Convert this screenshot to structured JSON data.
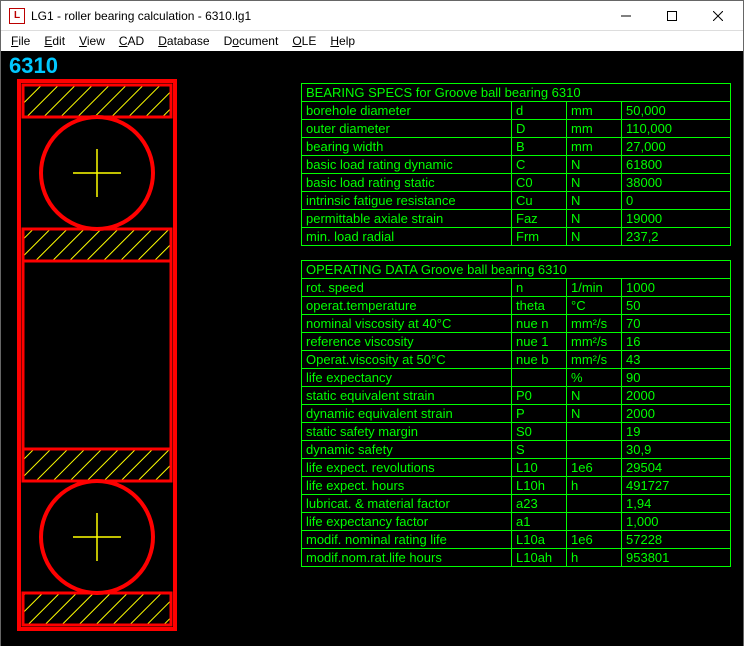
{
  "window": {
    "title": "LG1 -  roller bearing calculation  -  6310.lg1"
  },
  "menu": [
    "File",
    "Edit",
    "View",
    "CAD",
    "Database",
    "Document",
    "OLE",
    "Help"
  ],
  "part_label": "6310",
  "specs": {
    "title": "BEARING SPECS for Groove ball bearing 6310",
    "rows": [
      {
        "label": "borehole diameter",
        "sym": "d",
        "unit": "mm",
        "val": " 50,000"
      },
      {
        "label": "outer diameter",
        "sym": "D",
        "unit": "mm",
        "val": "110,000"
      },
      {
        "label": "bearing width",
        "sym": "B",
        "unit": "mm",
        "val": " 27,000"
      },
      {
        "label": "basic load rating dynamic",
        "sym": "C",
        "unit": "N",
        "val": "61800"
      },
      {
        "label": "basic load rating static",
        "sym": "C0",
        "unit": "N",
        "val": "38000"
      },
      {
        "label": "intrinsic fatigue resistance",
        "sym": "Cu",
        "unit": "N",
        "val": "0"
      },
      {
        "label": "permittable axiale strain",
        "sym": "Faz",
        "unit": "N",
        "val": "19000"
      },
      {
        "label": "min. load radial",
        "sym": "Frm",
        "unit": "N",
        "val": "237,2"
      }
    ]
  },
  "operating": {
    "title": "OPERATING DATA  Groove ball bearing 6310",
    "rows": [
      {
        "label": "rot. speed",
        "sym": "n",
        "unit": "1/min",
        "val": "1000"
      },
      {
        "label": "operat.temperature",
        "sym": "theta",
        "unit": "°C",
        "val": "50"
      },
      {
        "label": "nominal viscosity at 40°C",
        "sym": "nue n",
        "unit": "mm²/s",
        "val": "70"
      },
      {
        "label": "reference viscosity",
        "sym": "nue 1",
        "unit": "mm²/s",
        "val": "16"
      },
      {
        "label": "Operat.viscosity at 50°C",
        "sym": "nue b",
        "unit": "mm²/s",
        "val": "43"
      },
      {
        "label": "life expectancy",
        "sym": "",
        "unit": "%",
        "val": "90"
      },
      {
        "label": "static equivalent strain",
        "sym": "P0",
        "unit": "N",
        "val": "2000"
      },
      {
        "label": "dynamic equivalent strain",
        "sym": "P",
        "unit": "N",
        "val": "2000"
      },
      {
        "label": "static safety margin",
        "sym": "S0",
        "unit": "",
        "val": "19"
      },
      {
        "label": "dynamic safety",
        "sym": "S",
        "unit": "",
        "val": "30,9"
      },
      {
        "label": "life expect. revolutions",
        "sym": "L10",
        "unit": "1e6",
        "val": "29504"
      },
      {
        "label": "life expect. hours",
        "sym": "L10h",
        "unit": "h",
        "val": "491727"
      },
      {
        "label": "lubricat. & material factor",
        "sym": "a23",
        "unit": "",
        "val": "  1,94"
      },
      {
        "label": "life expectancy factor",
        "sym": "a1",
        "unit": "",
        "val": "1,000"
      },
      {
        "label": "modif. nominal rating life",
        "sym": "L10a",
        "unit": "1e6",
        "val": "57228"
      },
      {
        "label": "modif.nom.rat.life  hours",
        "sym": "L10ah",
        "unit": "h",
        "val": "953801"
      }
    ]
  }
}
